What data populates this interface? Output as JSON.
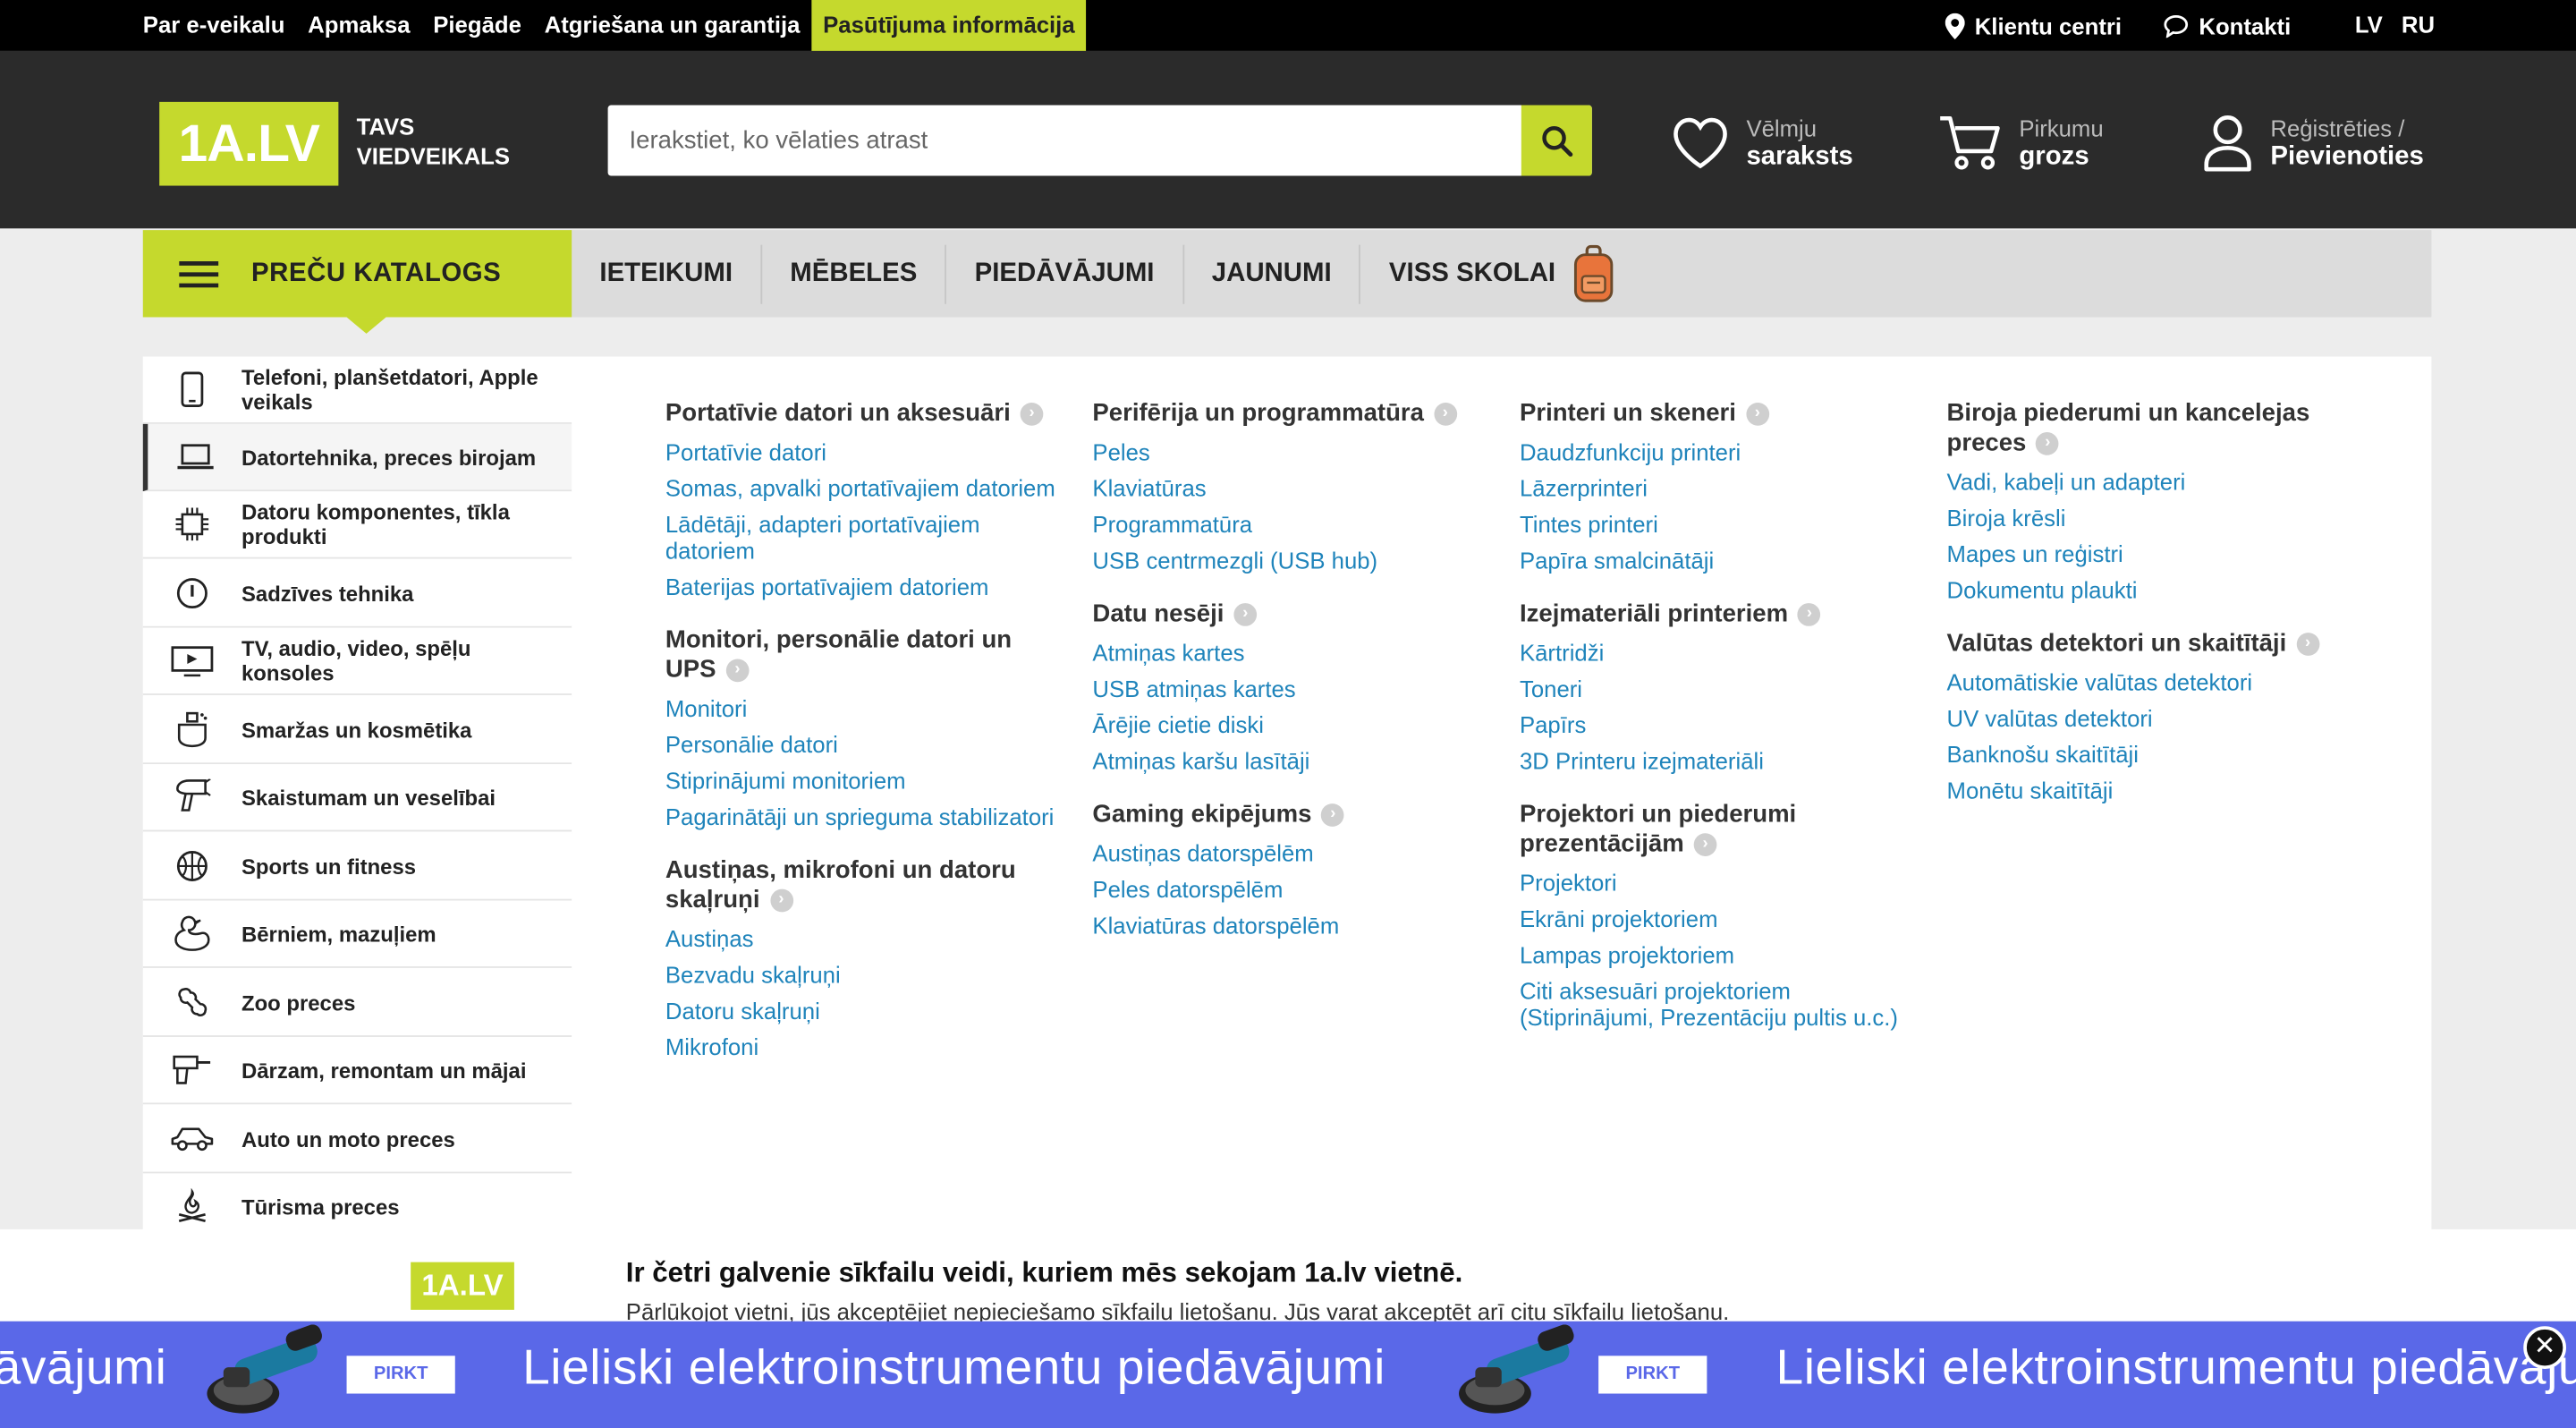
{
  "colors": {
    "accent": "#c5d92d",
    "link": "#1f84bb",
    "header_bg": "#2b2b2b",
    "banner_bg": "#5a68e8"
  },
  "topbar": {
    "links": [
      "Par e-veikalu",
      "Apmaksa",
      "Piegāde",
      "Atgriešana un garantija",
      "Pasūtījuma informācija"
    ],
    "client_centers": "Klientu centri",
    "contacts": "Kontakti",
    "lang_lv": "LV",
    "lang_ru": "RU"
  },
  "header": {
    "logo": "1A.LV",
    "tagline_1": "TAVS",
    "tagline_2": "VIEDVEIKALS",
    "search_placeholder": "Ierakstiet, ko vēlaties atrast",
    "wishlist_small": "Vēlmju",
    "wishlist_big": "saraksts",
    "cart_small": "Pirkumu",
    "cart_big": "grozs",
    "account_small": "Reģistrēties /",
    "account_big": "Pievienoties"
  },
  "nav": {
    "catalog": "PREČU KATALOGS",
    "links": [
      "IETEIKUMI",
      "MĒBELES",
      "PIEDĀVĀJUMI",
      "JAUNUMI",
      "VISS SKOLAI"
    ]
  },
  "sidebar": {
    "items": [
      {
        "label": "Telefoni, planšetdatori, Apple veikals",
        "icon": "phone-icon"
      },
      {
        "label": "Datortehnika, preces birojam",
        "icon": "laptop-icon"
      },
      {
        "label": "Datoru komponentes, tīkla produkti",
        "icon": "chip-icon"
      },
      {
        "label": "Sadzīves tehnika",
        "icon": "appliance-icon"
      },
      {
        "label": "TV, audio, video, spēļu konsoles",
        "icon": "tv-icon"
      },
      {
        "label": "Smaržas un kosmētika",
        "icon": "perfume-icon"
      },
      {
        "label": "Skaistumam un veselībai",
        "icon": "hairdryer-icon"
      },
      {
        "label": "Sports un fitness",
        "icon": "ball-icon"
      },
      {
        "label": "Bērniem, mazuļiem",
        "icon": "duck-icon"
      },
      {
        "label": "Zoo preces",
        "icon": "bone-icon"
      },
      {
        "label": "Dārzam, remontam un mājai",
        "icon": "drill-icon"
      },
      {
        "label": "Auto un moto preces",
        "icon": "car-icon"
      },
      {
        "label": "Tūrisma preces",
        "icon": "campfire-icon"
      }
    ]
  },
  "mega": {
    "columns": [
      [
        {
          "title": "Portatīvie datori un aksesuāri",
          "links": [
            "Portatīvie datori",
            "Somas, apvalki portatīvajiem datoriem",
            "Lādētāji, adapteri portatīvajiem datoriem",
            "Baterijas portatīvajiem datoriem"
          ]
        },
        {
          "title": "Monitori, personālie datori un UPS",
          "links": [
            "Monitori",
            "Personālie datori",
            "Stiprinājumi monitoriem",
            "Pagarinātāji un sprieguma stabilizatori"
          ]
        },
        {
          "title": "Austiņas, mikrofoni un datoru skaļruņi",
          "links": [
            "Austiņas",
            "Bezvadu skaļruņi",
            "Datoru skaļruņi",
            "Mikrofoni"
          ]
        }
      ],
      [
        {
          "title": "Perifērija un programmatūra",
          "links": [
            "Peles",
            "Klaviatūras",
            "Programmatūra",
            "USB centrmezgli (USB hub)"
          ]
        },
        {
          "title": "Datu nesēji",
          "links": [
            "Atmiņas kartes",
            "USB atmiņas kartes",
            "Ārējie cietie diski",
            "Atmiņas karšu lasītāji"
          ]
        },
        {
          "title": "Gaming ekipējums",
          "links": [
            "Austiņas datorspēlēm",
            "Peles datorspēlēm",
            "Klaviatūras datorspēlēm"
          ]
        }
      ],
      [
        {
          "title": "Printeri un skeneri",
          "links": [
            "Daudzfunkciju printeri",
            "Lāzerprinteri",
            "Tintes printeri",
            "Papīra smalcinātāji"
          ]
        },
        {
          "title": "Izejmateriāli printeriem",
          "links": [
            "Kārtridži",
            "Toneri",
            "Papīrs",
            "3D Printeru izejmateriāli"
          ]
        },
        {
          "title": "Projektori un piederumi prezentācijām",
          "links": [
            "Projektori",
            "Ekrāni projektoriem",
            "Lampas projektoriem",
            "Citi aksesuāri projektoriem (Stiprinājumi, Prezentāciju pultis u.c.)"
          ]
        }
      ],
      [
        {
          "title": "Biroja piederumi un kancelejas preces",
          "links": [
            "Vadi, kabeļi un adapteri",
            "Biroja krēsli",
            "Mapes un reģistri",
            "Dokumentu plaukti"
          ]
        },
        {
          "title": "Valūtas detektori un skaitītāji",
          "links": [
            "Automātiskie valūtas detektori",
            "UV valūtas detektori",
            "Banknošu skaitītāji",
            "Monētu skaitītāji"
          ]
        }
      ]
    ]
  },
  "cookie": {
    "logo": "1A.LV",
    "title": "Ir četri galvenie sīkfailu veidi, kuriem mēs sekojam 1a.lv vietnē.",
    "text": "Pārlūkojot vietni, jūs akceptējiet nepieciešamo sīkfailu lietošanu. Jūs varat akceptēt arī citu sīkfailu lietošanu."
  },
  "banner": {
    "text": "Lieliski elektroinstrumentu piedāvājumi",
    "text_left_fragment": "āvājumi",
    "cta": "PIRKT",
    "close": "✕"
  }
}
